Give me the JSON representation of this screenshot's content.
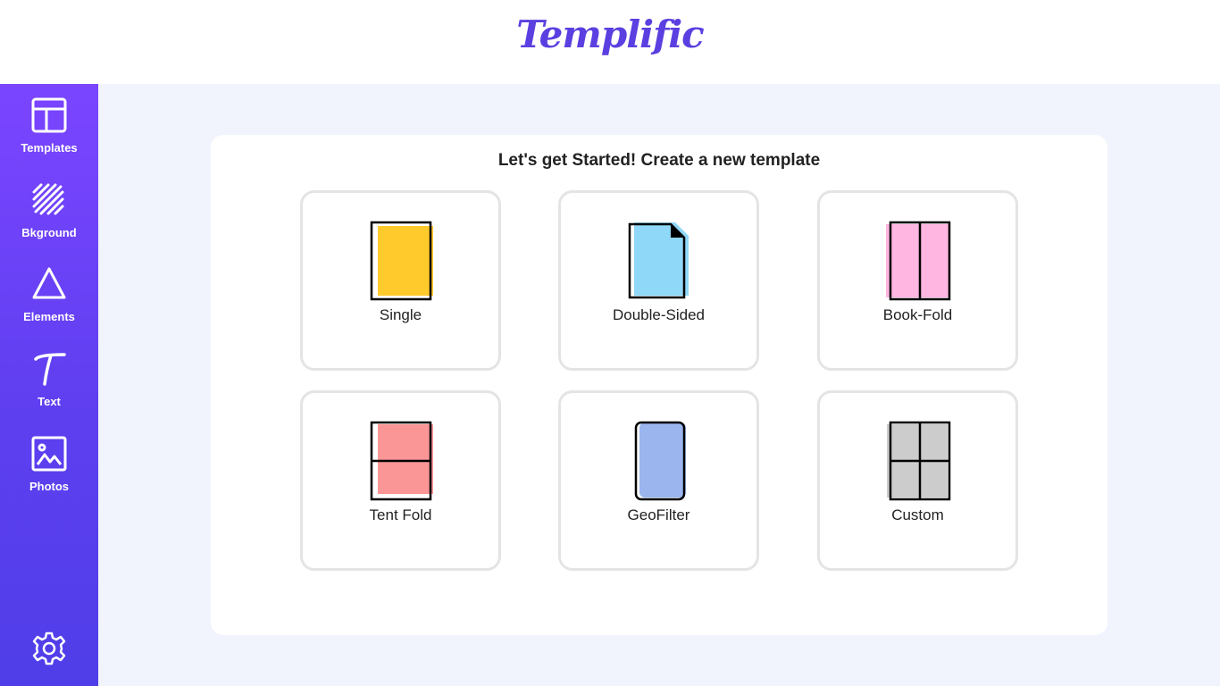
{
  "header": {
    "logo_text": "Templific"
  },
  "sidebar": {
    "items": [
      {
        "label": "Templates",
        "icon": "layout-icon"
      },
      {
        "label": "Bkground",
        "icon": "stripes-icon"
      },
      {
        "label": "Elements",
        "icon": "triangle-icon"
      },
      {
        "label": "Text",
        "icon": "text-icon"
      },
      {
        "label": "Photos",
        "icon": "photo-icon"
      }
    ],
    "settings_icon": "gear-icon"
  },
  "main": {
    "title": "Let's get Started! Create a new template",
    "options": [
      {
        "label": "Single",
        "icon": "single-page-icon",
        "color": "#ffca2c"
      },
      {
        "label": "Double-Sided",
        "icon": "double-sided-icon",
        "color": "#8fd8f8"
      },
      {
        "label": "Book-Fold",
        "icon": "book-fold-icon",
        "color": "#ffb6e1"
      },
      {
        "label": "Tent Fold",
        "icon": "tent-fold-icon",
        "color": "#fb9696"
      },
      {
        "label": "GeoFilter",
        "icon": "geofilter-icon",
        "color": "#9bb6ef"
      },
      {
        "label": "Custom",
        "icon": "custom-grid-icon",
        "color": "#cccccc"
      }
    ]
  },
  "colors": {
    "accent": "#5b3fe0",
    "sidebar_top": "#7b45ff",
    "sidebar_bottom": "#4f3ee8",
    "background": "#f1f4fd"
  }
}
